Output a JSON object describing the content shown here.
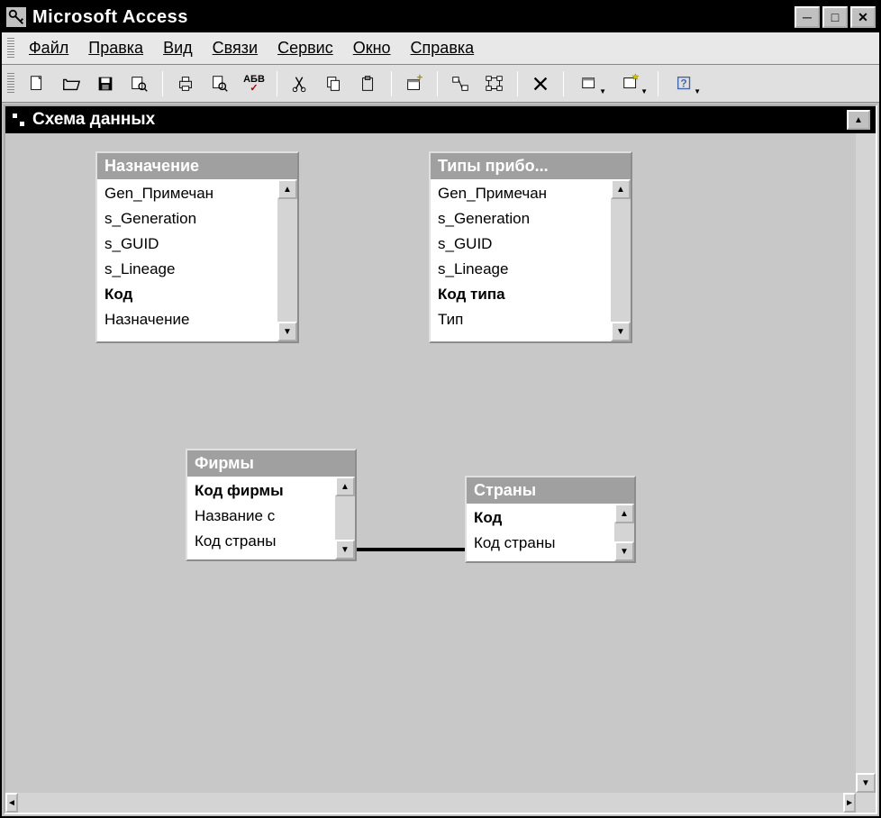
{
  "app": {
    "title": "Microsoft Access"
  },
  "menu": {
    "file": "Файл",
    "edit": "Правка",
    "view": "Вид",
    "relations": "Связи",
    "service": "Сервис",
    "window": "Окно",
    "help": "Справка"
  },
  "child": {
    "title": "Схема данных"
  },
  "toolbar_icons": {
    "new": "new-icon",
    "open": "open-icon",
    "save": "save-icon",
    "search": "search-icon",
    "print": "print-icon",
    "preview": "preview-icon",
    "spell": "spell-icon",
    "cut": "cut-icon",
    "copy": "copy-icon",
    "paste": "paste-icon",
    "showtable": "show-table-icon",
    "directrel": "direct-relations-icon",
    "allrel": "all-relations-icon",
    "delete": "delete-icon",
    "newobj": "new-object-icon",
    "autoform": "autoform-icon",
    "helpq": "help-icon"
  },
  "tables": {
    "t1": {
      "title": "Назначение",
      "fields": [
        "Gen_Примечан",
        "s_Generation",
        "s_GUID",
        "s_Lineage",
        "Код",
        "Назначение"
      ],
      "pk": "Код"
    },
    "t2": {
      "title": "Типы прибо...",
      "fields": [
        "Gen_Примечан",
        "s_Generation",
        "s_GUID",
        "s_Lineage",
        "Код типа",
        "Тип"
      ],
      "pk": "Код типа"
    },
    "t3": {
      "title": "Фирмы",
      "fields": [
        "Код фирмы",
        "Название с",
        "Код страны"
      ],
      "pk": "Код фирмы"
    },
    "t4": {
      "title": "Страны",
      "fields": [
        "Код",
        "Код страны"
      ],
      "pk": "Код"
    }
  }
}
